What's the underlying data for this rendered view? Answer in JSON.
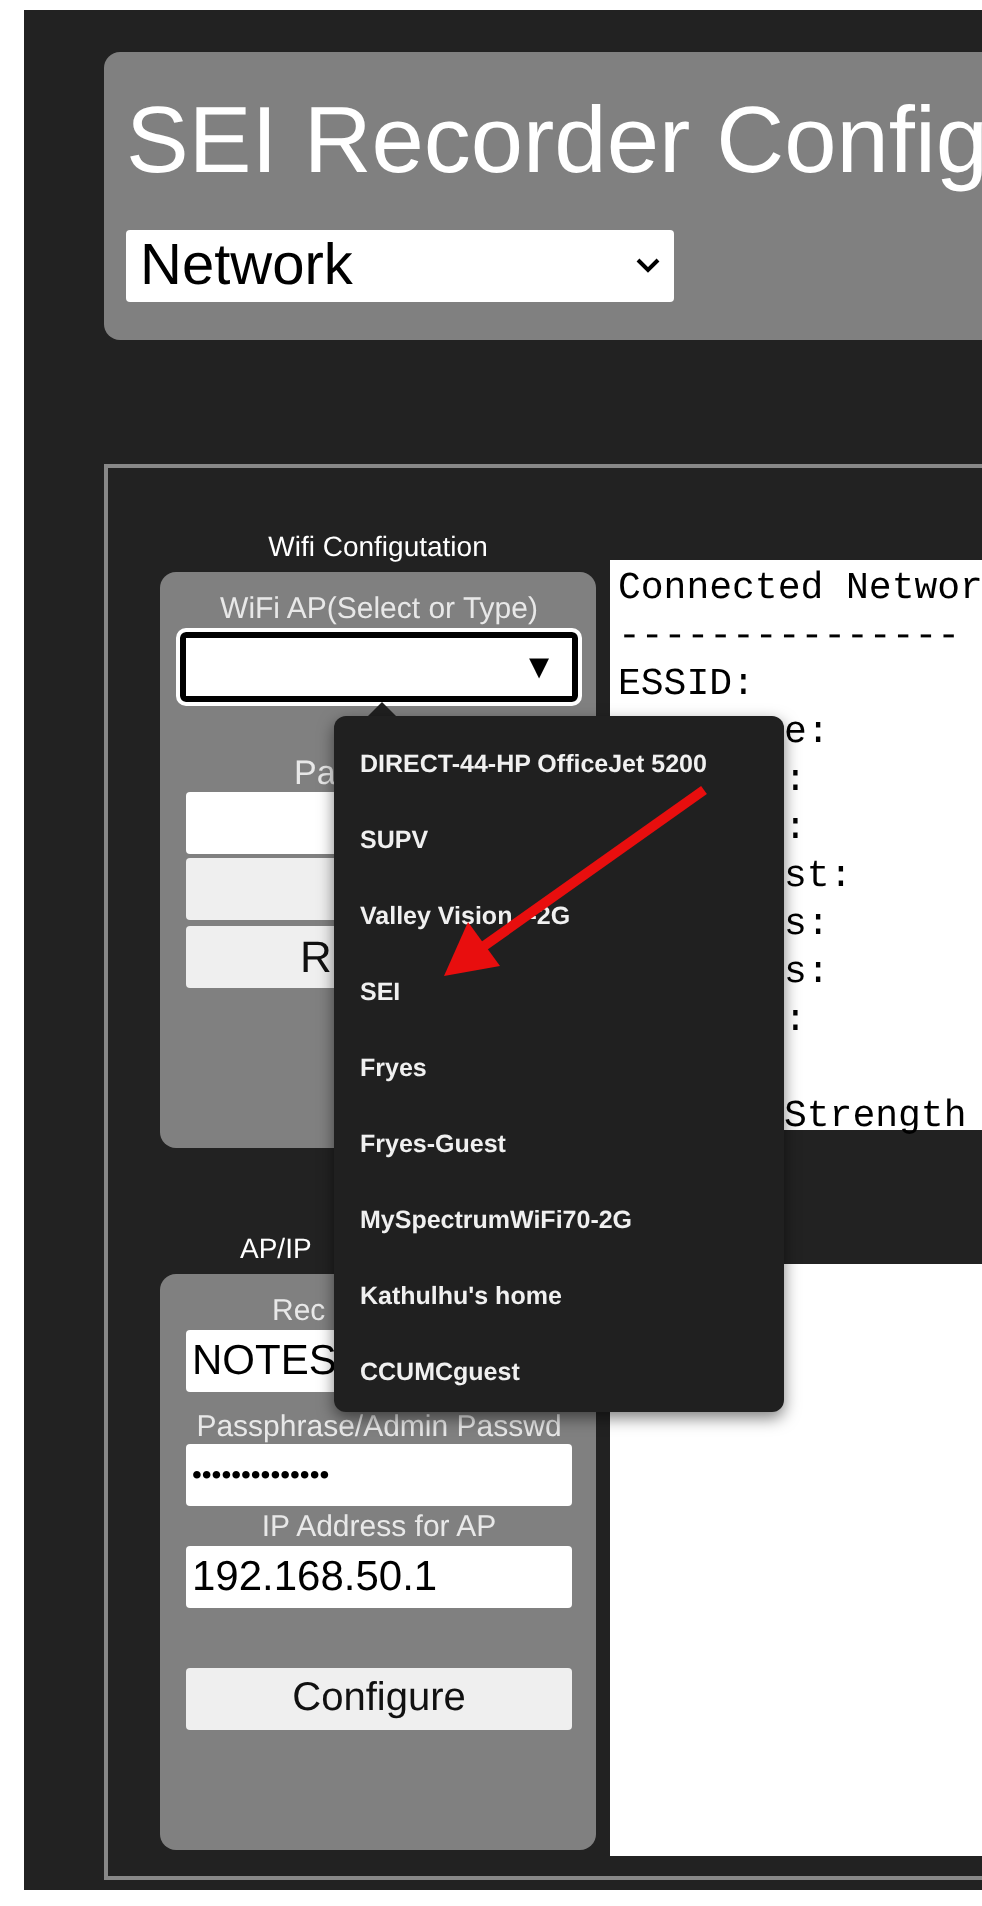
{
  "header": {
    "title": "SEI Recorder Config",
    "section_select": {
      "value": "Network"
    }
  },
  "wifi_config": {
    "heading": "Wifi Configutation",
    "ap_label": "WiFi AP(Select or Type)",
    "ap_arrow": "▼",
    "passphrase_label": "Pa",
    "restart_button": "R"
  },
  "ap_config": {
    "heading": "AP/IP",
    "name_label": "Rec",
    "name_value": "NOTES",
    "password_label": "Passphrase/Admin Passwd",
    "password_value": "••••••••••••••",
    "ip_label": "IP Address for AP",
    "ip_value": "192.168.50.1",
    "configure_button": "Configure"
  },
  "status_output": {
    "lines": [
      {
        "kind": "full",
        "text": "Connected Networ"
      },
      {
        "kind": "full",
        "text": "---------------"
      },
      {
        "kind": "full",
        "text": "ESSID:"
      },
      {
        "kind": "partial",
        "text": "e:"
      },
      {
        "kind": "partial",
        "text": ":"
      },
      {
        "kind": "partial",
        "text": ":"
      },
      {
        "kind": "partial",
        "text": "st:"
      },
      {
        "kind": "partial",
        "text": "s:"
      },
      {
        "kind": "partial",
        "text": "s:"
      },
      {
        "kind": "partial",
        "text": ":"
      },
      {
        "kind": "partial"
      },
      {
        "kind": "partial",
        "text": "Strength"
      }
    ]
  },
  "ap_dropdown": {
    "items": [
      "DIRECT-44-HP OfficeJet 5200",
      "SUPV",
      "Valley Vision",
      "SEI",
      "Fryes",
      "Fryes-Guest",
      "MySpectrumWiFi70-2G",
      "Kathulhu's home",
      "CCUMCguest"
    ],
    "valley_suffix": "-2G"
  }
}
